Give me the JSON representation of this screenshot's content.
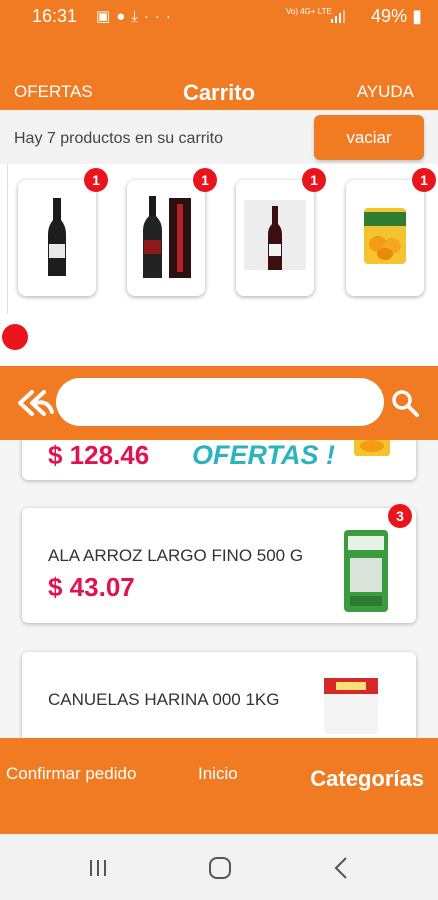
{
  "status_bar": {
    "time": "16:31",
    "icons": [
      "image-icon",
      "facebook-icon",
      "download-icon",
      "more-icon"
    ],
    "overflow": "···",
    "network": "Vo) 4G+ LTE",
    "battery": "49%"
  },
  "header": {
    "left_link": "OFERTAS",
    "title": "Carrito",
    "right_link": "AYUDA"
  },
  "info_bar": {
    "message": "Hay 7 productos en su carrito",
    "clear_button": "vaciar"
  },
  "cart_items": [
    {
      "type": "wine-bottle",
      "badge": "1"
    },
    {
      "type": "wine-bottle-with-box",
      "badge": "1"
    },
    {
      "type": "wine-bottle",
      "badge": "1"
    },
    {
      "type": "canned-fruit",
      "badge": "1"
    }
  ],
  "search": {
    "placeholder": "",
    "value": ""
  },
  "products": [
    {
      "name": "",
      "price": "$ 128.46",
      "promo": "OFERTAS !",
      "badge": ""
    },
    {
      "name": "ALA ARROZ  LARGO FINO 500 G",
      "price": "$ 43.07",
      "promo": "",
      "badge": "3"
    },
    {
      "name": "CANUELAS HARINA 000 1KG",
      "price": "",
      "promo": "",
      "badge": ""
    }
  ],
  "bottom_bar": {
    "confirm": "Confirmar pedido",
    "home": "Inicio",
    "categories": "Categorías"
  },
  "colors": {
    "accent": "#f07b22",
    "badge": "#e8151d",
    "price": "#e0124f",
    "promo": "#2bb3c0"
  }
}
